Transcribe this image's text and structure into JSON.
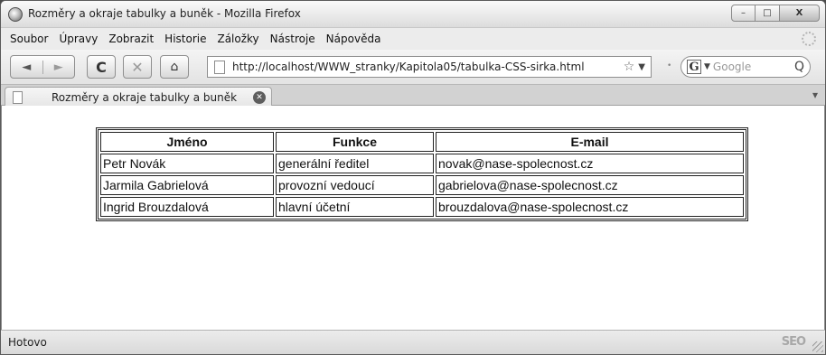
{
  "window": {
    "title": "Rozměry a okraje tabulky a buněk - Mozilla Firefox",
    "controls": {
      "minimize": "–",
      "maximize": "□",
      "close": "X"
    }
  },
  "menu": [
    "Soubor",
    "Úpravy",
    "Zobrazit",
    "Historie",
    "Záložky",
    "Nástroje",
    "Nápověda"
  ],
  "toolbar": {
    "back_glyph": "◄",
    "forward_glyph": "►",
    "reload_glyph": "C",
    "stop_glyph": "✕",
    "home_glyph": "⌂",
    "url": "http://localhost/WWW_stranky/Kapitola05/tabulka-CSS-sirka.html",
    "bookmark_glyph": "☆",
    "url_dropdown_glyph": "▼",
    "feed_glyph": "•",
    "search_engine": "G",
    "search_dropdown_glyph": "▼",
    "search_placeholder": "Google",
    "search_glyph": "Q"
  },
  "tabs": [
    {
      "label": "Rozměry a okraje tabulky a buněk",
      "close_glyph": "✕"
    }
  ],
  "tablist_glyph": "▾",
  "table": {
    "headers": [
      "Jméno",
      "Funkce",
      "E-mail"
    ],
    "rows": [
      [
        "Petr Novák",
        "generální ředitel",
        "novak@nase-spolecnost.cz"
      ],
      [
        "Jarmila Gabrielová",
        "provozní vedoucí",
        "gabrielova@nase-spolecnost.cz"
      ],
      [
        "Ingrid Brouzdalová",
        "hlavní účetní",
        "brouzdalova@nase-spolecnost.cz"
      ]
    ]
  },
  "status": {
    "text": "Hotovo",
    "addon_label": "SEO"
  },
  "icons": {
    "app": "firefox-icon",
    "page": "page-icon",
    "search": "search-icon"
  }
}
